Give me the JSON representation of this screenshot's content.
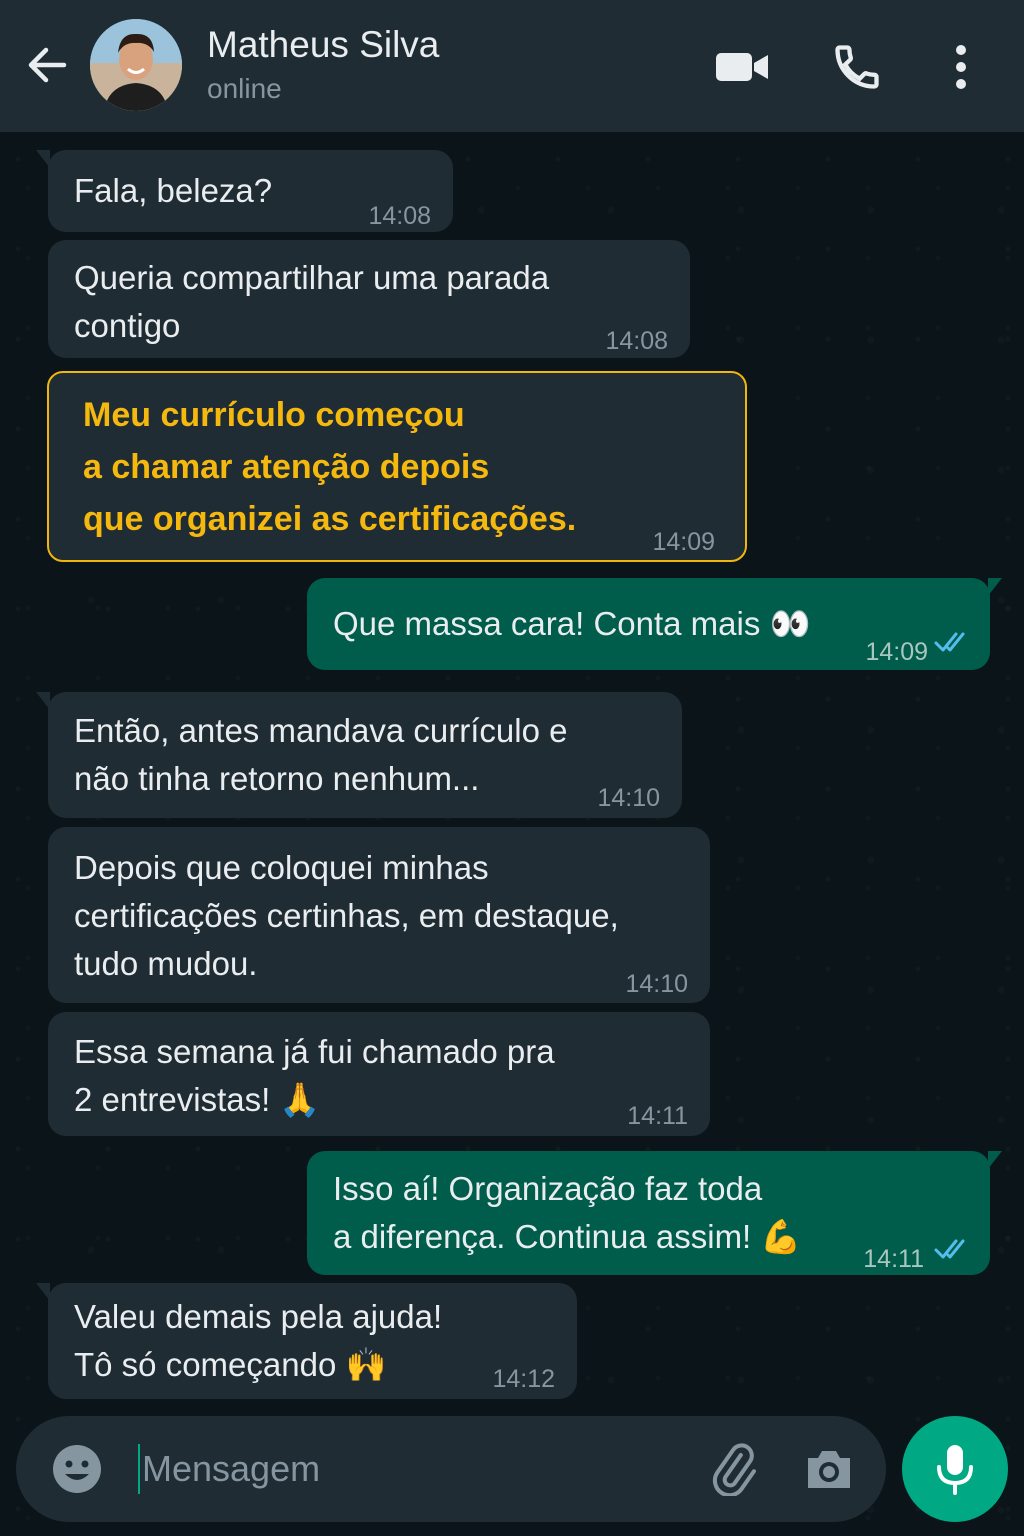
{
  "header": {
    "contact_name": "Matheus Silva",
    "status": "online"
  },
  "messages": [
    {
      "direction": "in",
      "text": "Fala, beleza?",
      "time": "14:08"
    },
    {
      "direction": "in",
      "text": "Queria compartilhar uma parada\ncontigo",
      "time": "14:08"
    },
    {
      "direction": "in",
      "highlight": true,
      "text": "Meu currículo começou\na chamar atenção depois\nque organizei as certificações.",
      "time": "14:09"
    },
    {
      "direction": "out",
      "text": "Que massa cara! Conta mais 👀",
      "time": "14:09",
      "status": "read"
    },
    {
      "direction": "in",
      "text": "Então, antes mandava currículo e\nnão tinha retorno nenhum...",
      "time": "14:10"
    },
    {
      "direction": "in",
      "text": "Depois que coloquei minhas\ncertificações certinhas, em destaque,\ntudo mudou.",
      "time": "14:10"
    },
    {
      "direction": "in",
      "text": "Essa semana já fui chamado pra\n2 entrevistas!   🙏",
      "time": "14:11"
    },
    {
      "direction": "out",
      "text": "Isso aí! Organização faz toda\na diferença. Continua assim! 💪",
      "time": "14:11",
      "status": "read"
    },
    {
      "direction": "in",
      "text": "Valeu demais pela ajuda!\nTô só começando 🙌",
      "time": "14:12"
    }
  ],
  "composer": {
    "placeholder": "Mensagem"
  },
  "colors": {
    "header_bg": "#1f2c33",
    "chat_bg": "#0b1418",
    "incoming_bubble": "#1f2c33",
    "outgoing_bubble": "#005c4b",
    "accent": "#00a884",
    "highlight": "#f5b80f",
    "read_ticks": "#53bdeb"
  },
  "icons": {
    "back": "arrow-left-icon",
    "video": "video-camera-icon",
    "call": "phone-icon",
    "menu": "more-vertical-icon",
    "emoji": "emoji-icon",
    "attach": "paperclip-icon",
    "camera": "camera-icon",
    "mic": "microphone-icon",
    "read": "double-check-icon"
  }
}
